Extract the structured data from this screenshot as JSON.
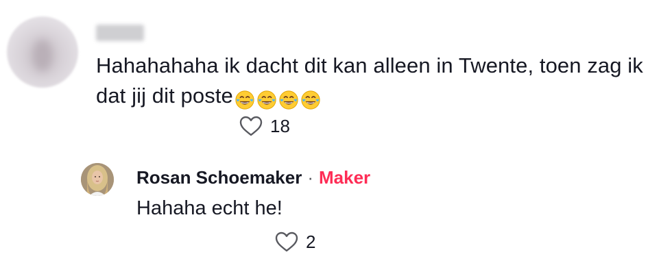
{
  "comment": {
    "text": "Hahahahaha ik dacht dit kan alleen in Twente, toen zag ik dat jij dit poste",
    "emojis": [
      "tears-of-joy",
      "tears-of-joy",
      "tears-of-joy",
      "tears-of-joy"
    ],
    "like_count": "18"
  },
  "reply": {
    "author": "Rosan Schoemaker",
    "separator": "·",
    "badge": "Maker",
    "text": "Hahaha echt he!",
    "like_count": "2"
  },
  "colors": {
    "text": "#161823",
    "badge": "#fe2c55",
    "muted": "#58595f"
  },
  "icons": {
    "like": "heart-outline-icon",
    "emoji": "face-with-tears-of-joy-icon"
  }
}
